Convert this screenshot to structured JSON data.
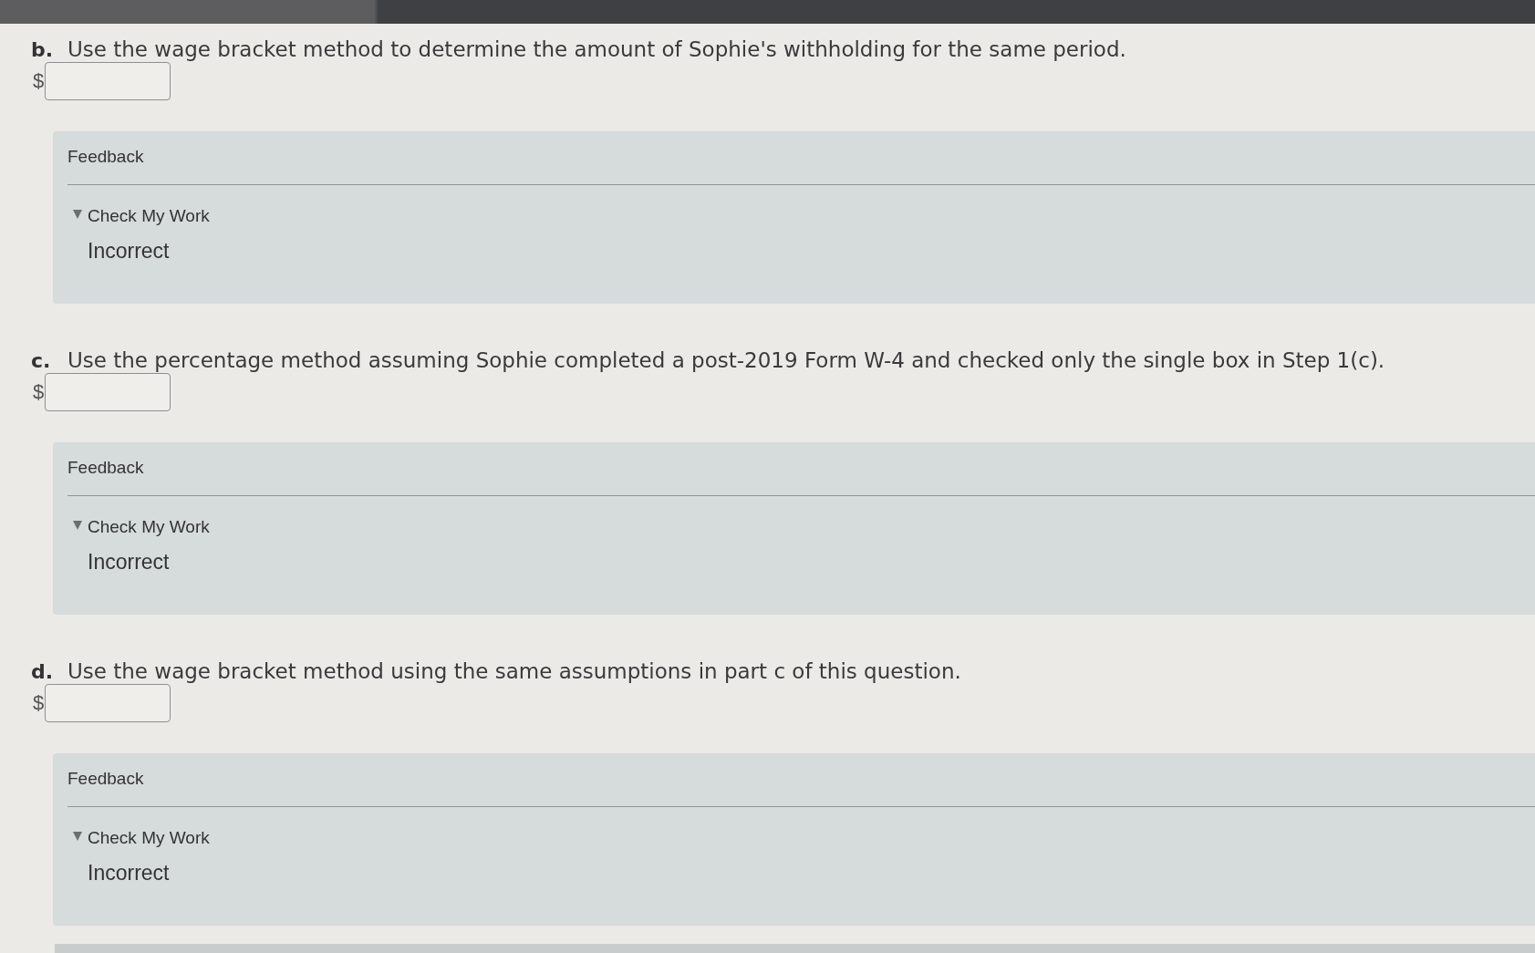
{
  "questions": [
    {
      "label": "b.",
      "prompt": "Use the wage bracket method to determine the amount of Sophie's withholding for the same period.",
      "currency": "$",
      "feedback": {
        "title": "Feedback",
        "check": {
          "label": "Check My Work",
          "expanded": true,
          "result": "Incorrect"
        }
      }
    },
    {
      "label": "c.",
      "prompt": "Use the percentage method assuming Sophie completed a post-2019 Form W-4 and checked only the single box in Step 1(c).",
      "currency": "$",
      "feedback": {
        "title": "Feedback",
        "check": {
          "label": "Check My Work",
          "expanded": true,
          "result": "Incorrect"
        }
      }
    },
    {
      "label": "d.",
      "prompt": "Use the wage bracket method using the same assumptions in part c of this question.",
      "currency": "$",
      "feedback": {
        "title": "Feedback",
        "check": {
          "label": "Check My Work",
          "expanded": true,
          "result": "Incorrect"
        }
      }
    }
  ]
}
